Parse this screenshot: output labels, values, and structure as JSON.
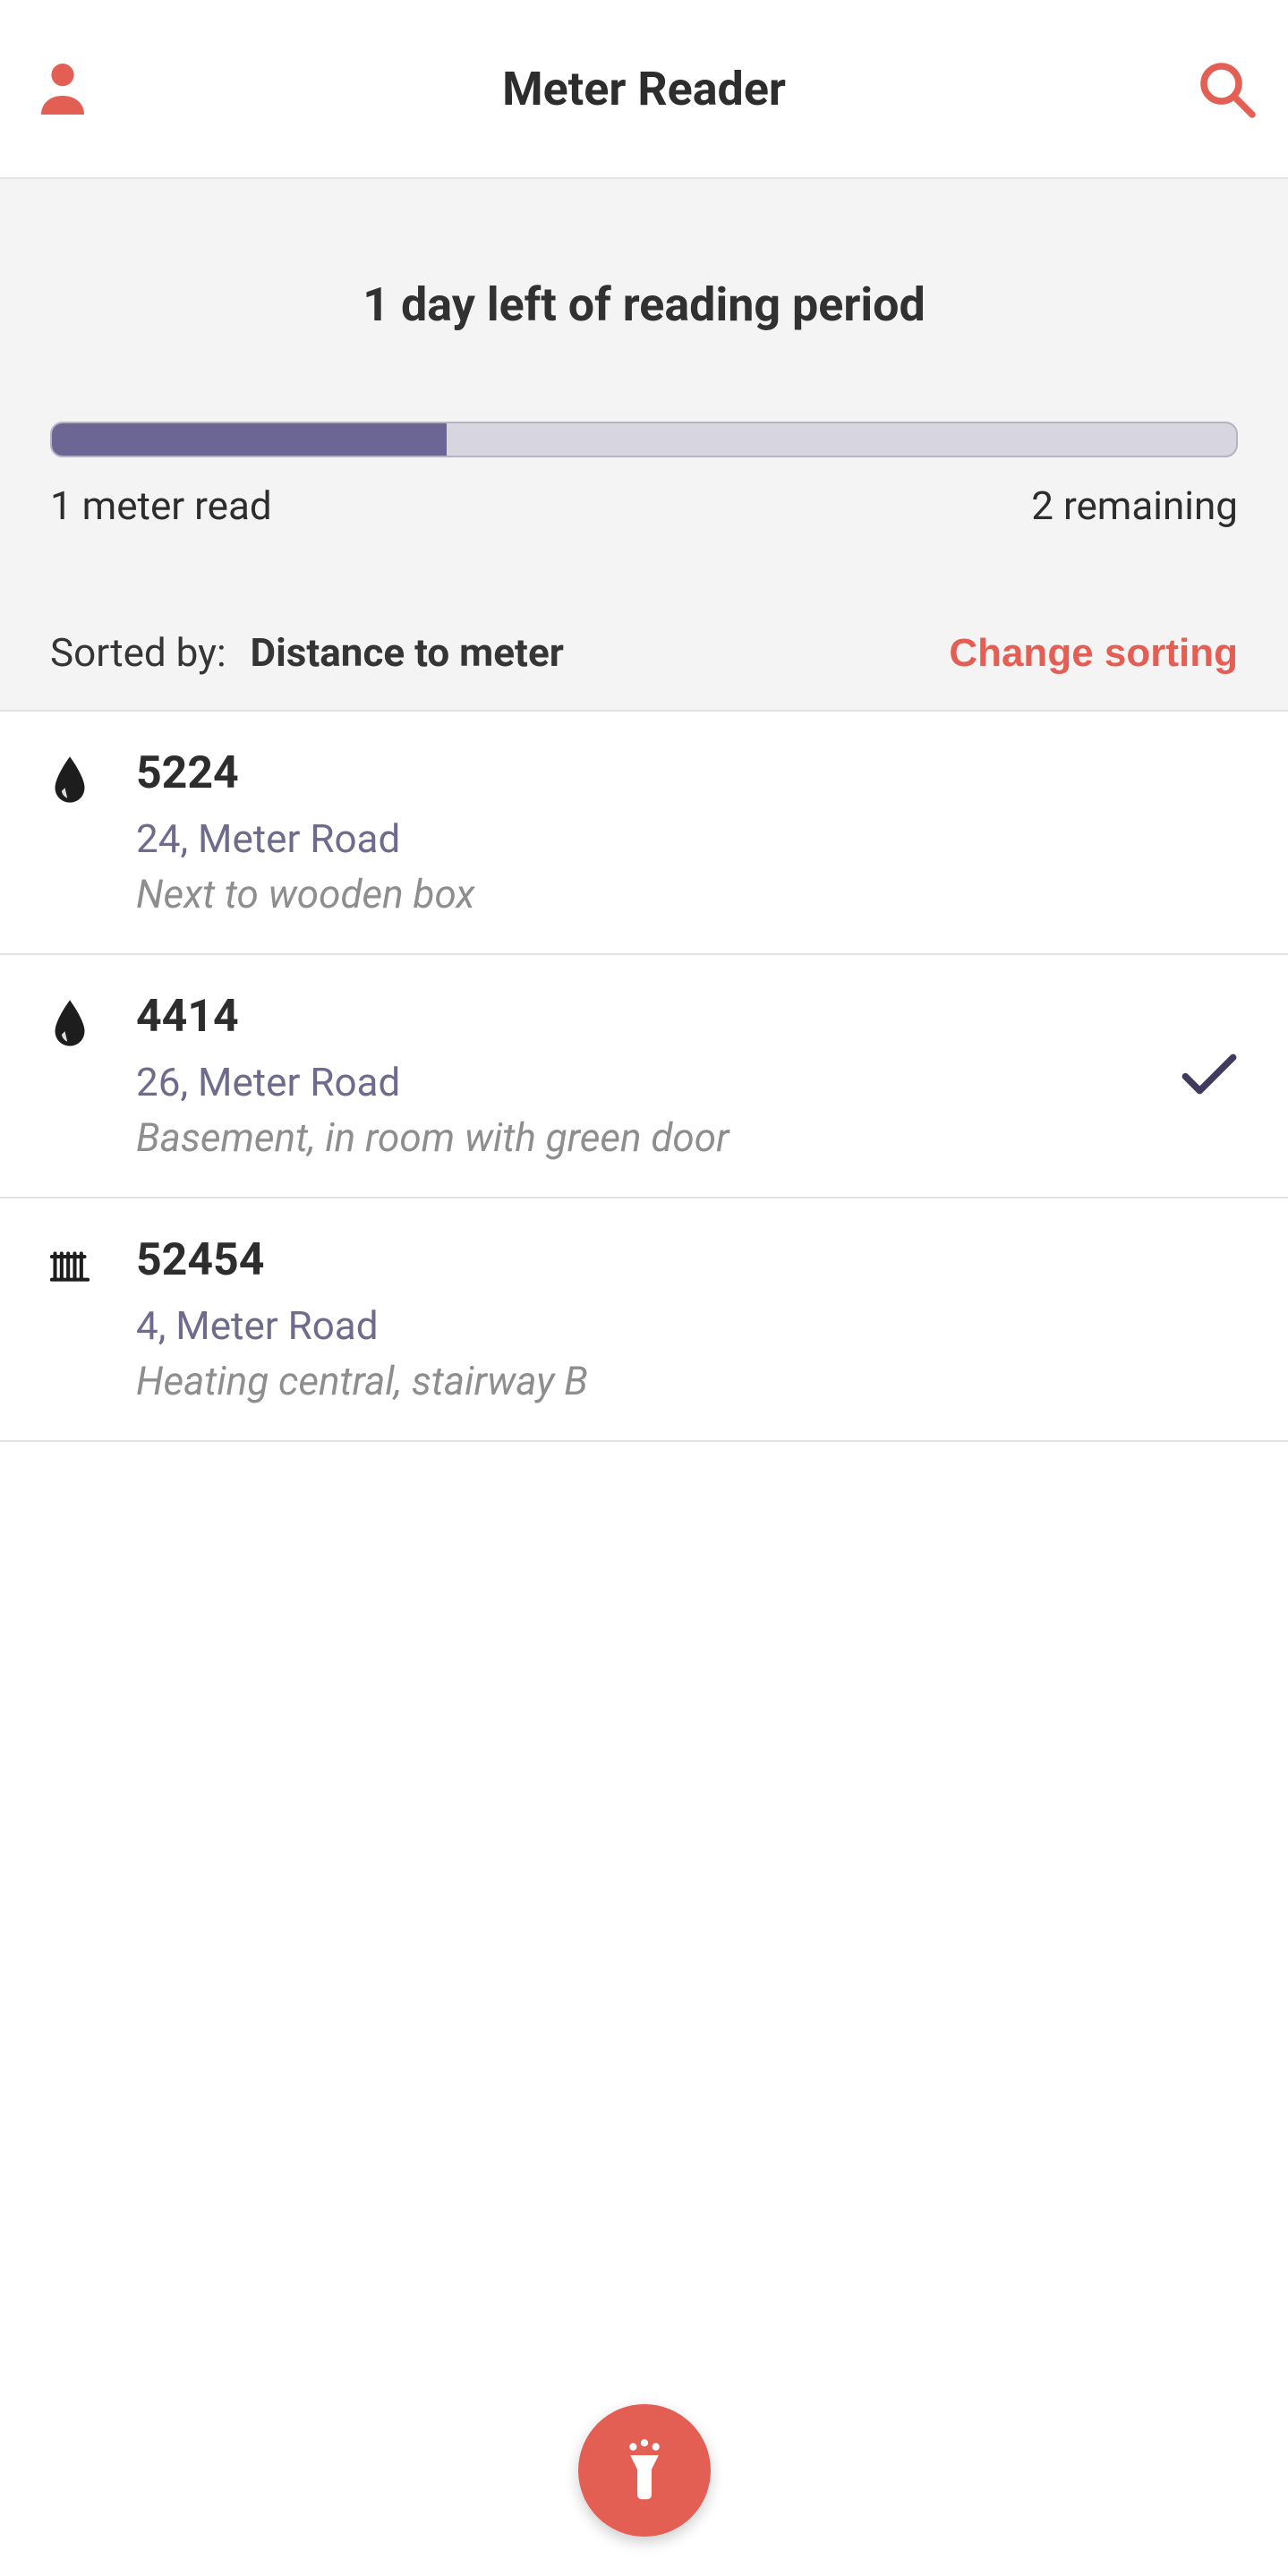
{
  "header": {
    "title": "Meter Reader"
  },
  "period": {
    "heading": "1 day left of reading period",
    "progress_percent": 33.333,
    "read_label": "1 meter read",
    "remaining_label": "2 remaining"
  },
  "sort": {
    "prefix": "Sorted by:",
    "criterion": "Distance to meter",
    "change_label": "Change sorting"
  },
  "meters": [
    {
      "icon": "water",
      "id": "5224",
      "address": "24, Meter Road",
      "note": "Next to wooden box",
      "done": false
    },
    {
      "icon": "water",
      "id": "4414",
      "address": "26, Meter Road",
      "note": "Basement, in room with green door",
      "done": true
    },
    {
      "icon": "heat",
      "id": "52454",
      "address": "4, Meter Road",
      "note": "Heating central, stairway B",
      "done": false
    }
  ],
  "colors": {
    "accent": "#e35e53",
    "secondary": "#6b6694"
  }
}
